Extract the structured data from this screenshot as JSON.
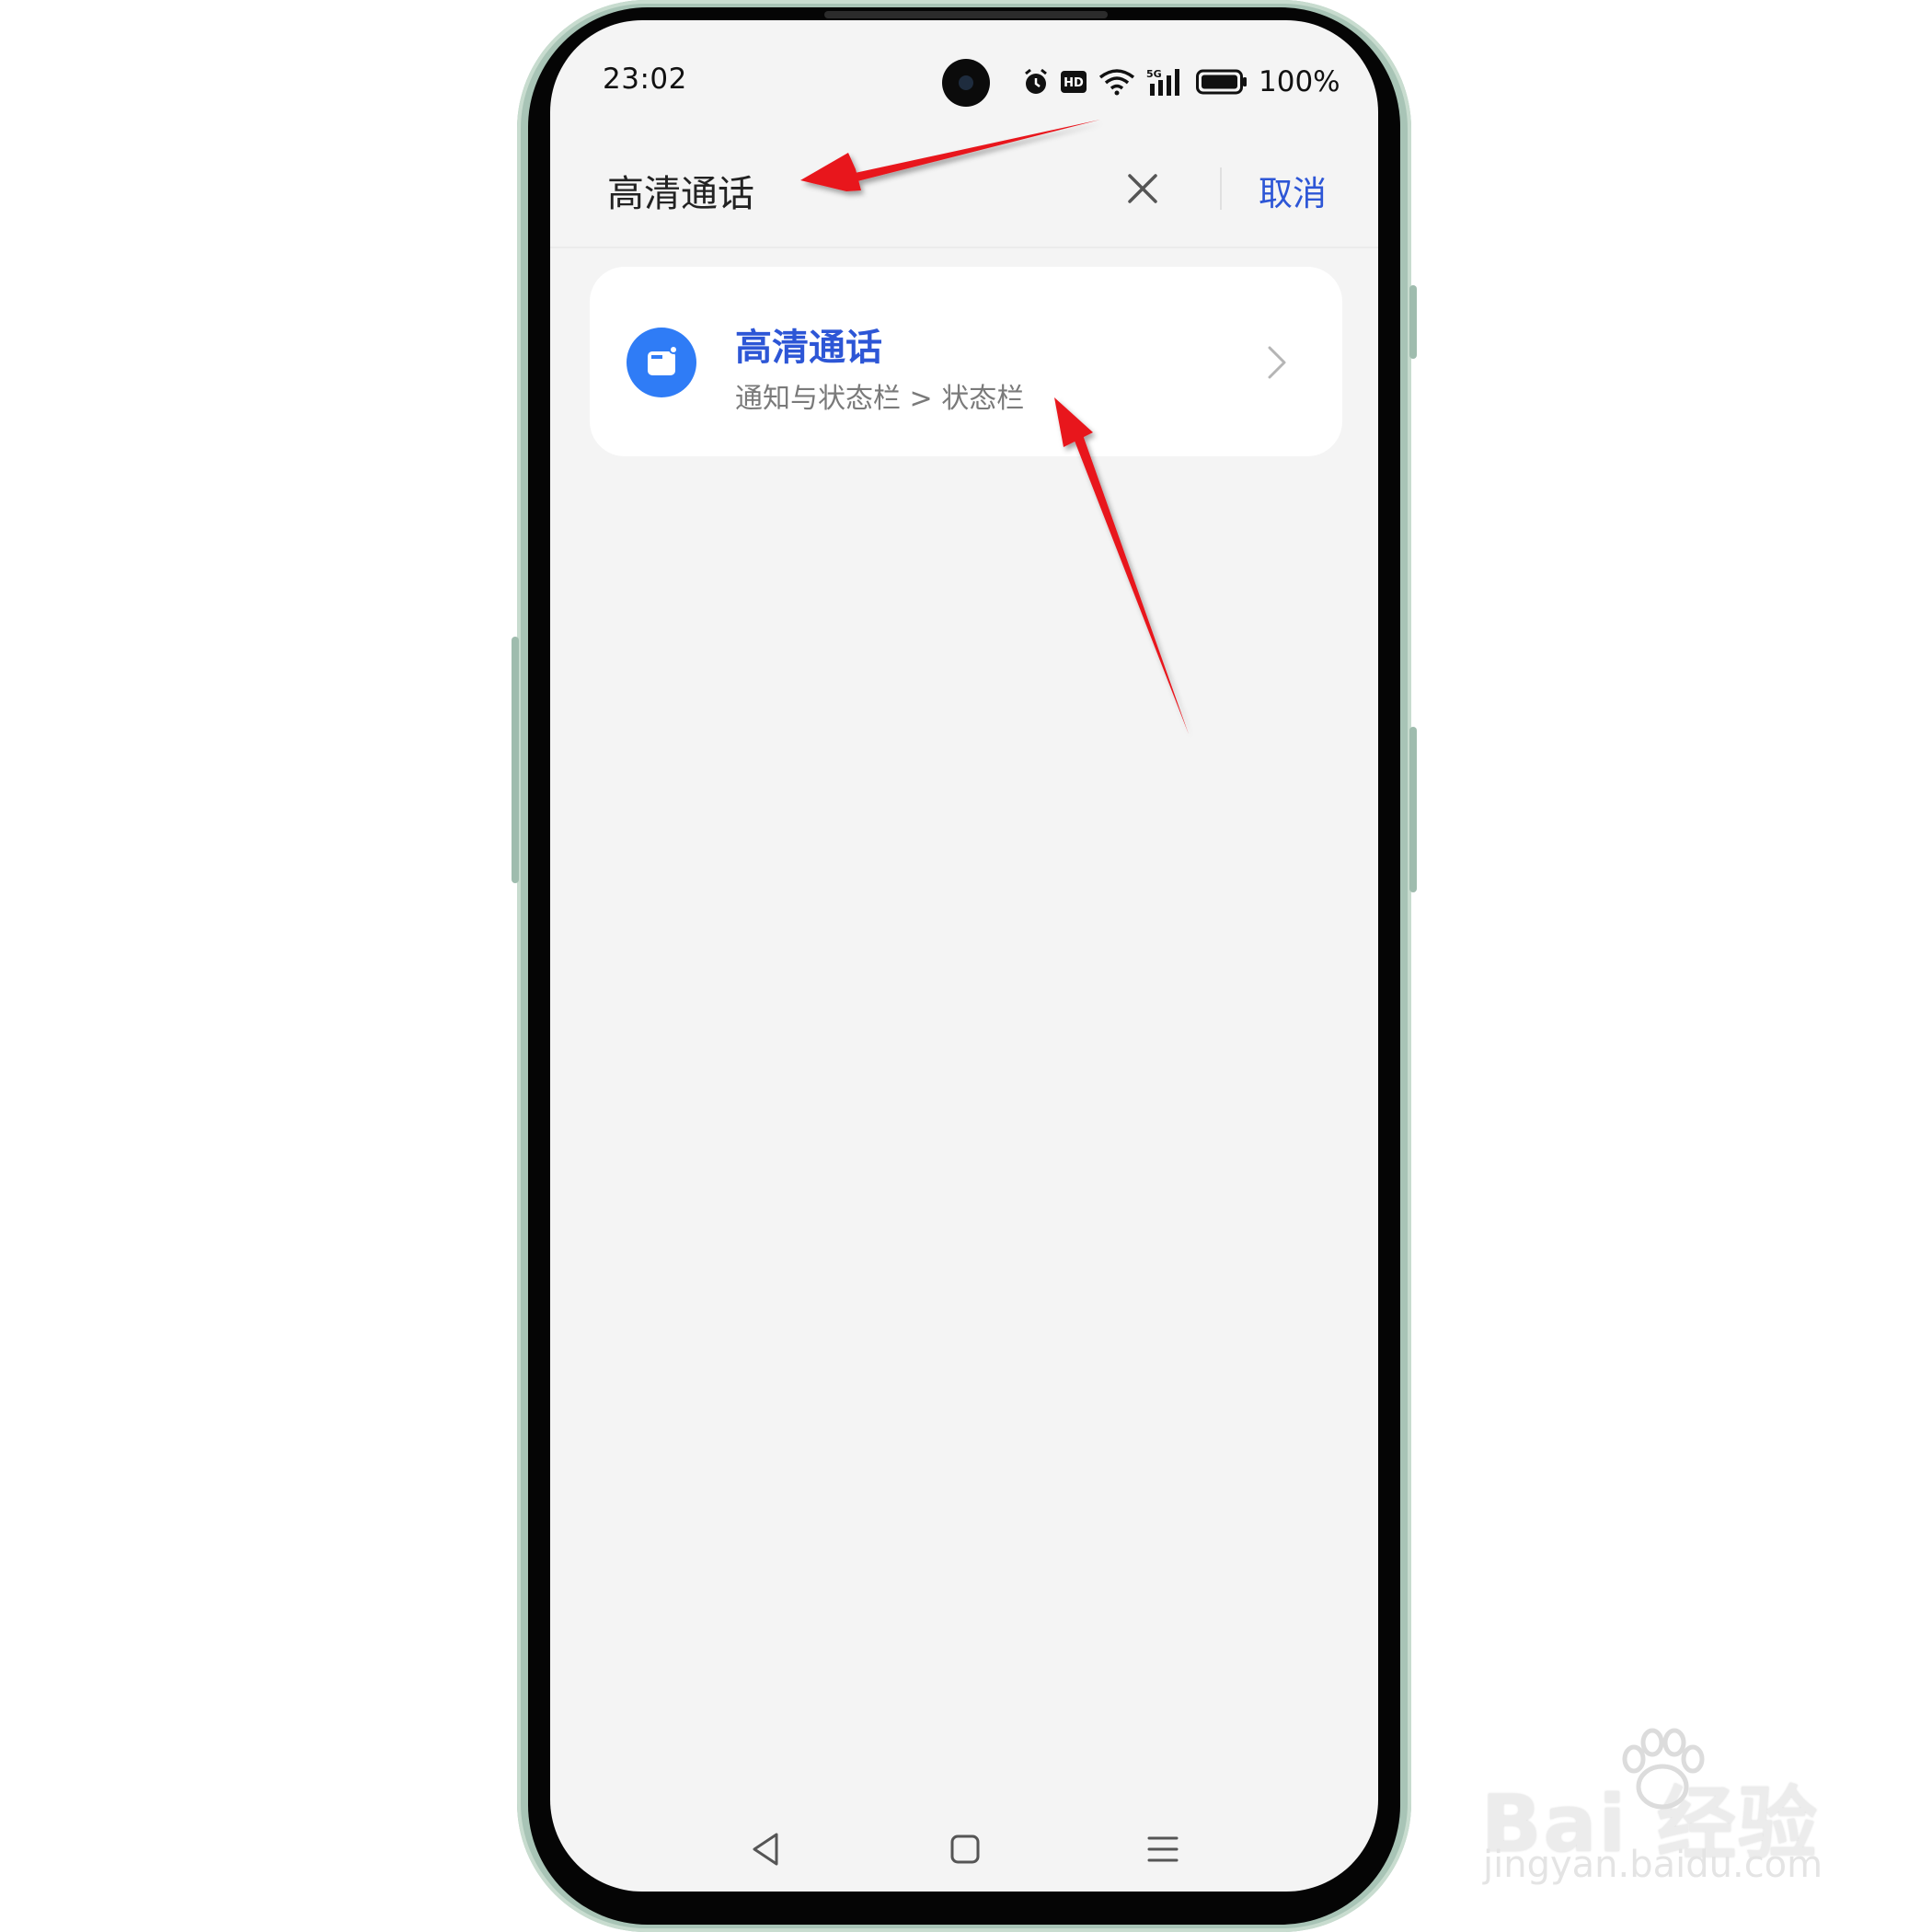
{
  "status_bar": {
    "time": "23:02",
    "battery_text": "100%",
    "icons": [
      "alarm-icon",
      "hd-icon",
      "wifi-icon",
      "5g-signal-icon",
      "battery-icon"
    ]
  },
  "search": {
    "query": "高清通话",
    "clear_icon": "close-icon",
    "cancel_label": "取消"
  },
  "results": [
    {
      "title": "高清通话",
      "path": "通知与状态栏 > 状态栏",
      "icon": "hd-call-icon"
    }
  ],
  "nav_bar": {
    "icons": [
      "back-icon",
      "home-icon",
      "menu-icon"
    ]
  },
  "watermark": {
    "brand": "Bai  经验",
    "url": "jingyan.baidu.com"
  },
  "colors": {
    "accent": "#2d56d6",
    "icon_blue": "#2f7cf6",
    "screen_bg": "#f4f4f4",
    "annotation_red": "#e8131b"
  }
}
